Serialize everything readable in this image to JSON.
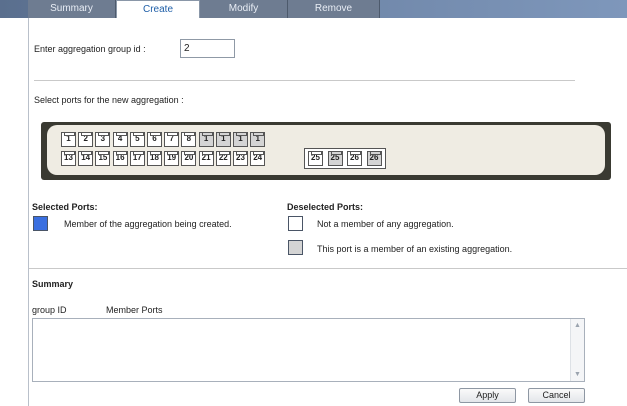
{
  "tabs": [
    {
      "label": "Summary",
      "active": false
    },
    {
      "label": "Create",
      "active": true
    },
    {
      "label": "Modify",
      "active": false
    },
    {
      "label": "Remove",
      "active": false
    }
  ],
  "group_id": {
    "label": "Enter aggregation group id :",
    "value": "2"
  },
  "select_ports_label": "Select ports for the new aggregation :",
  "ports": {
    "top_row": [
      {
        "label": "1",
        "member": false
      },
      {
        "label": "2",
        "member": false
      },
      {
        "label": "3",
        "member": false
      },
      {
        "label": "4",
        "member": false
      },
      {
        "label": "5",
        "member": false
      },
      {
        "label": "6",
        "member": false
      },
      {
        "label": "7",
        "member": false
      },
      {
        "label": "8",
        "member": false
      },
      {
        "label": "1",
        "member": true
      },
      {
        "label": "1",
        "member": true
      },
      {
        "label": "1",
        "member": true
      },
      {
        "label": "1",
        "member": true
      }
    ],
    "bottom_row": [
      {
        "label": "13",
        "member": false
      },
      {
        "label": "14",
        "member": false
      },
      {
        "label": "15",
        "member": false
      },
      {
        "label": "16",
        "member": false
      },
      {
        "label": "17",
        "member": false
      },
      {
        "label": "18",
        "member": false
      },
      {
        "label": "19",
        "member": false
      },
      {
        "label": "20",
        "member": false
      },
      {
        "label": "21",
        "member": false
      },
      {
        "label": "22",
        "member": false
      },
      {
        "label": "23",
        "member": false
      },
      {
        "label": "24",
        "member": false
      }
    ],
    "sfp_row": [
      {
        "label": "25",
        "member": false
      },
      {
        "label": "25",
        "member": true
      },
      {
        "label": "26",
        "member": false
      },
      {
        "label": "26",
        "member": true
      }
    ]
  },
  "legend": {
    "selected_heading": "Selected Ports:",
    "selected_text": "Member of the aggregation being created.",
    "deselected_heading": "Deselected Ports:",
    "not_member_text": "Not a member of any aggregation.",
    "existing_member_text": "This port is a member of an existing aggregation.",
    "colors": {
      "selected": "#3a6fe0",
      "not_member": "#ffffff",
      "existing_member": "#d4d4d4"
    }
  },
  "summary": {
    "heading": "Summary",
    "columns": [
      "group ID",
      "Member Ports"
    ]
  },
  "buttons": {
    "apply": "Apply",
    "cancel": "Cancel"
  }
}
